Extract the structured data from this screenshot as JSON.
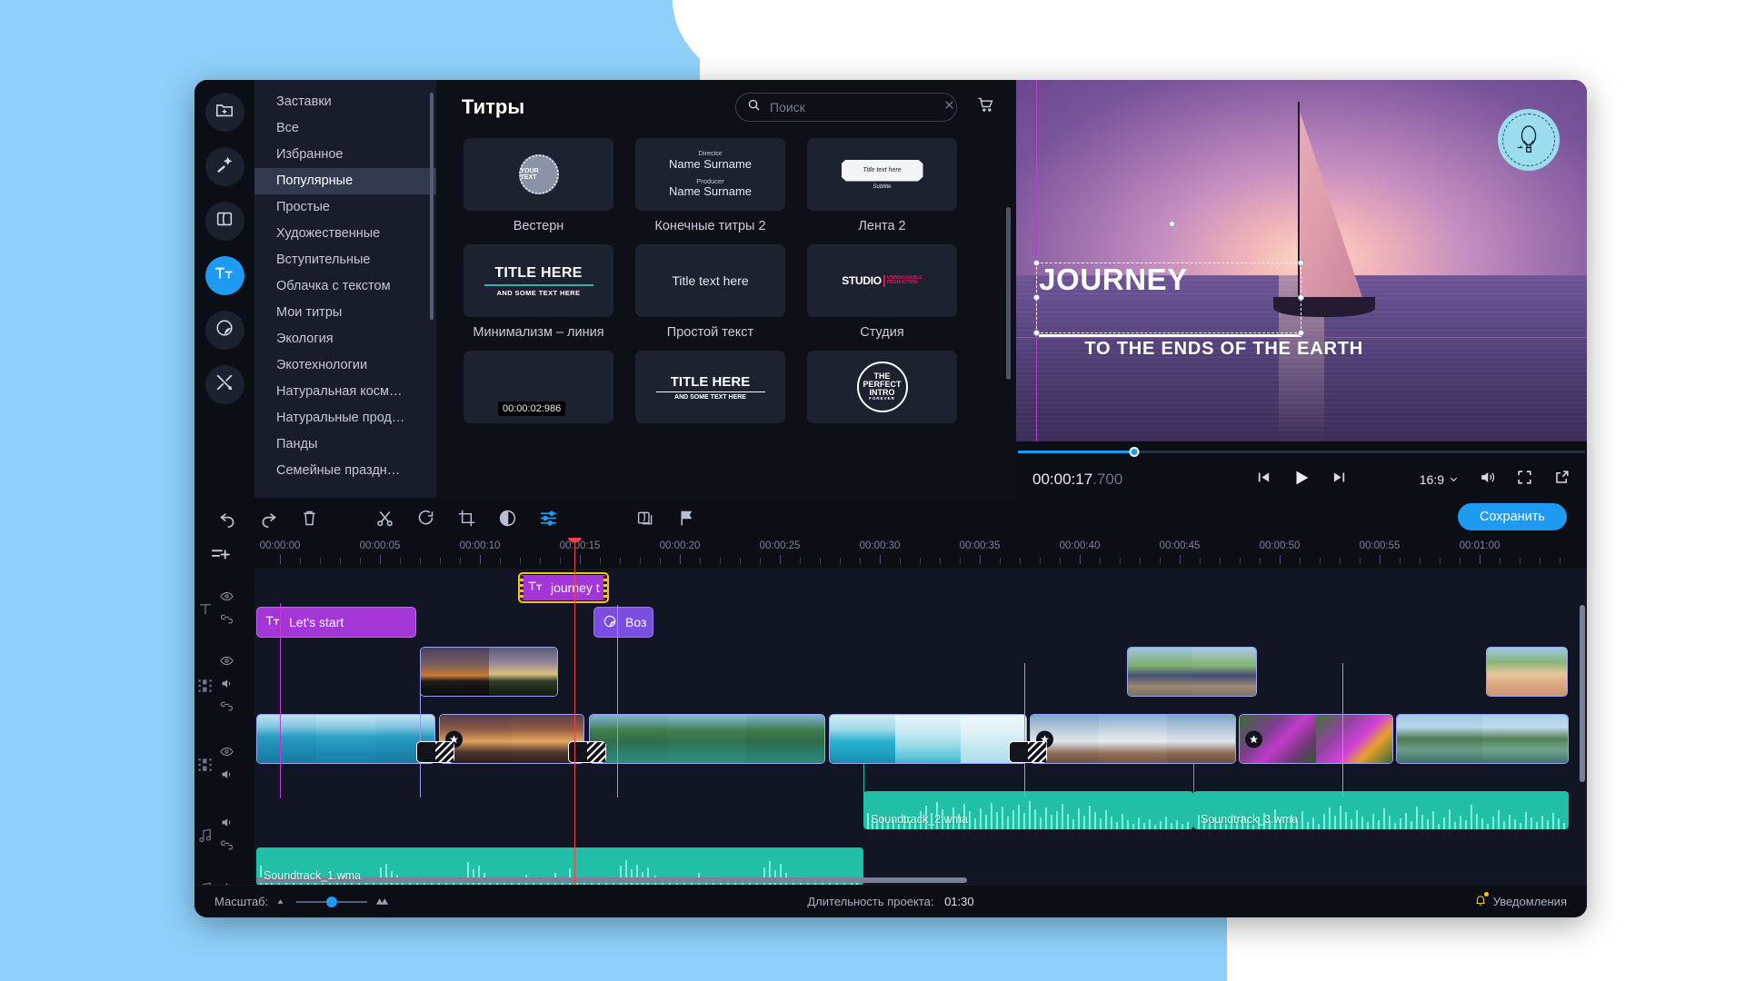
{
  "rail": {
    "items": [
      {
        "name": "import-media",
        "icon": "folder-plus-icon",
        "active": false
      },
      {
        "name": "filters",
        "icon": "magic-wand-icon",
        "active": false
      },
      {
        "name": "transitions",
        "icon": "transition-icon",
        "active": false
      },
      {
        "name": "titles",
        "icon": "titles-icon",
        "active": true
      },
      {
        "name": "stickers",
        "icon": "sticker-icon",
        "active": false
      },
      {
        "name": "tools",
        "icon": "tools-icon",
        "active": false
      }
    ]
  },
  "categories": {
    "items": [
      {
        "label": "Заставки",
        "selected": false
      },
      {
        "label": "Все",
        "selected": false
      },
      {
        "label": "Избранное",
        "selected": false
      },
      {
        "label": "Популярные",
        "selected": true
      },
      {
        "label": "Простые",
        "selected": false
      },
      {
        "label": "Художественные",
        "selected": false
      },
      {
        "label": "Вступительные",
        "selected": false
      },
      {
        "label": "Облачка с текстом",
        "selected": false
      },
      {
        "label": "Мои титры",
        "selected": false
      },
      {
        "label": "Экология",
        "selected": false
      },
      {
        "label": "Экотехнологии",
        "selected": false
      },
      {
        "label": "Натуральная косм…",
        "selected": false
      },
      {
        "label": "Натуральные прод…",
        "selected": false
      },
      {
        "label": "Панды",
        "selected": false
      },
      {
        "label": "Семейные праздн…",
        "selected": false
      }
    ]
  },
  "browser": {
    "title": "Титры",
    "search": {
      "value": "",
      "placeholder": "Поиск"
    },
    "clear_icon": "close-icon",
    "search_icon": "search-icon",
    "cart_icon": "cart-icon",
    "tiles": [
      {
        "label": "Вестерн",
        "art": "western",
        "art_text": {
          "main": "YOUR TEXT",
          "ring": "TITLE TEXT HERE"
        }
      },
      {
        "label": "Конечные титры 2",
        "art": "credits",
        "art_text": {
          "l1": "Director",
          "l2": "Name Surname",
          "l3": "Producer",
          "l4": "Name Surname"
        }
      },
      {
        "label": "Лента 2",
        "art": "ribbon",
        "art_text": {
          "main": "Title text here",
          "sub": "Subtitle"
        }
      },
      {
        "label": "Минимализм – линия",
        "art": "minimal",
        "art_text": {
          "t1": "TITLE HERE",
          "t2": "AND SOME TEXT HERE"
        }
      },
      {
        "label": "Простой текст",
        "art": "simple",
        "art_text": {
          "t1": "Title text here"
        }
      },
      {
        "label": "Студия",
        "art": "studio",
        "art_text": {
          "t1": "STUDIO",
          "t2": "UNIMAGINABLE",
          "t3": "PRODUCTION"
        }
      },
      {
        "label": "",
        "art": "blank",
        "duration": "00:00:02:986"
      },
      {
        "label": "",
        "art": "title2",
        "art_text": {
          "t1": "TITLE HERE",
          "t2": "AND SOME TEXT HERE"
        }
      },
      {
        "label": "",
        "art": "intro",
        "art_text": {
          "t1": "THE",
          "t2": "PERFECT",
          "t3": "INTRO",
          "t4": "FOREVER"
        }
      }
    ]
  },
  "player": {
    "title_text": "JOURNEY",
    "subtitle_text": "TO THE ENDS OF THE EARTH",
    "current_time_main": "00:00:17",
    "current_time_ms": ".700",
    "progress_percent": 20.5,
    "aspect_ratio": "16:9",
    "controls": {
      "prev_frame": "prev-frame-icon",
      "play": "play-icon",
      "next_frame": "next-frame-icon",
      "volume": "volume-icon",
      "fullscreen": "fullscreen-icon",
      "detach": "detach-icon",
      "ratio_chevron": "chevron-down-icon"
    }
  },
  "toolbar": {
    "buttons": [
      {
        "name": "undo-button",
        "icon": "undo-icon",
        "active": false
      },
      {
        "name": "redo-button",
        "icon": "redo-icon",
        "active": false
      },
      {
        "name": "delete-button",
        "icon": "trash-icon",
        "active": false
      },
      {
        "name": "split-button",
        "icon": "scissors-icon",
        "active": false
      },
      {
        "name": "rotate-button",
        "icon": "rotate-icon",
        "active": false
      },
      {
        "name": "crop-button",
        "icon": "crop-icon",
        "active": false
      },
      {
        "name": "color-adjust-button",
        "icon": "contrast-icon",
        "active": false
      },
      {
        "name": "properties-button",
        "icon": "sliders-icon",
        "active": true
      },
      {
        "name": "overlay-button",
        "icon": "overlay-icon",
        "active": false
      },
      {
        "name": "marker-button",
        "icon": "flag-icon",
        "active": false
      }
    ],
    "save_label": "Сохранить",
    "add_track_icon": "add-track-icon"
  },
  "timeline": {
    "ruler_labels": [
      "00:00:00",
      "00:00:05",
      "00:00:10",
      "00:00:15",
      "00:00:20",
      "00:00:25",
      "00:00:30",
      "00:00:35",
      "00:00:40",
      "00:00:45",
      "00:00:50",
      "00:00:55",
      "00:01:00"
    ],
    "playhead_time": "00:00:17.700",
    "tracks": [
      {
        "name": "title-track",
        "icon": "title-track-icon",
        "controls": [
          "eye-icon",
          "link-icon"
        ]
      },
      {
        "name": "overlay-track",
        "icon": "video-track-icon",
        "controls": [
          "eye-icon",
          "volume-icon",
          "link-icon"
        ]
      },
      {
        "name": "main-video-track",
        "icon": "video-track-icon",
        "controls": [
          "eye-icon",
          "volume-icon"
        ]
      },
      {
        "name": "music-track",
        "icon": "music-note-icon",
        "controls": [
          "volume-icon",
          "link-icon"
        ]
      },
      {
        "name": "extra-audio-track",
        "icon": "music-note-icon",
        "controls": [
          "volume-icon"
        ]
      }
    ],
    "clips": {
      "titles": [
        {
          "label": "Let's start",
          "icon": "titles-icon",
          "selected": false
        },
        {
          "label": "journey t",
          "icon": "titles-icon",
          "selected": true
        }
      ],
      "stickers": [
        {
          "label": "Воз",
          "icon": "sticker-icon"
        }
      ],
      "audio": [
        {
          "label": "Soundtrack_2.wma"
        },
        {
          "label": "Soundtrack_3.wma"
        },
        {
          "label": "Soundtrack_1.wma"
        }
      ]
    }
  },
  "statusbar": {
    "zoom_label": "Масштаб:",
    "duration_label": "Длительность проекта:",
    "duration_value": "01:30",
    "notifications_label": "Уведомления",
    "bell_icon": "bell-icon",
    "zoom_out_icon": "zoom-out-icon",
    "zoom_in_icon": "zoom-in-icon"
  },
  "colors": {
    "accent": "#1e9bf0",
    "title_clip": "#a435d6",
    "sticker_clip": "#7b4de0",
    "audio_clip": "#21bfa6",
    "selection": "#f4c21b",
    "playhead": "#ef4545",
    "page_bg": "#8ed0fb"
  }
}
